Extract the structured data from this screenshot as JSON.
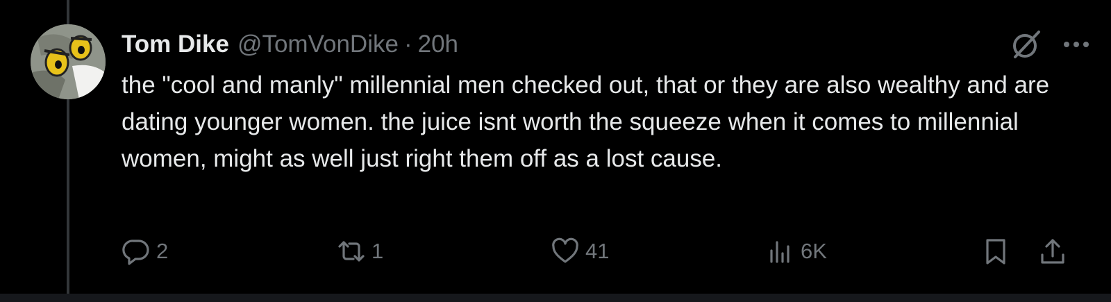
{
  "tweet": {
    "author": {
      "display_name": "Tom Dike",
      "handle": "@TomVonDike"
    },
    "separator": "·",
    "timestamp": "20h",
    "text": "the \"cool and manly\" millennial men checked out, that or they are also wealthy and are dating younger women. the juice isnt worth the squeeze when it comes to millennial women, might as well just right them off as a lost cause.",
    "actions": {
      "reply": {
        "icon": "reply-icon",
        "count": "2"
      },
      "repost": {
        "icon": "repost-icon",
        "count": "1"
      },
      "like": {
        "icon": "heart-icon",
        "count": "41"
      },
      "views": {
        "icon": "views-icon",
        "count": "6K"
      },
      "bookmark": {
        "icon": "bookmark-icon"
      },
      "share": {
        "icon": "share-icon"
      }
    },
    "header_icons": [
      "grok-icon",
      "more-icon"
    ]
  },
  "colors": {
    "background": "#000000",
    "primary_text": "#e7e9ea",
    "secondary_text": "#71767b",
    "thread_line": "#333639"
  }
}
